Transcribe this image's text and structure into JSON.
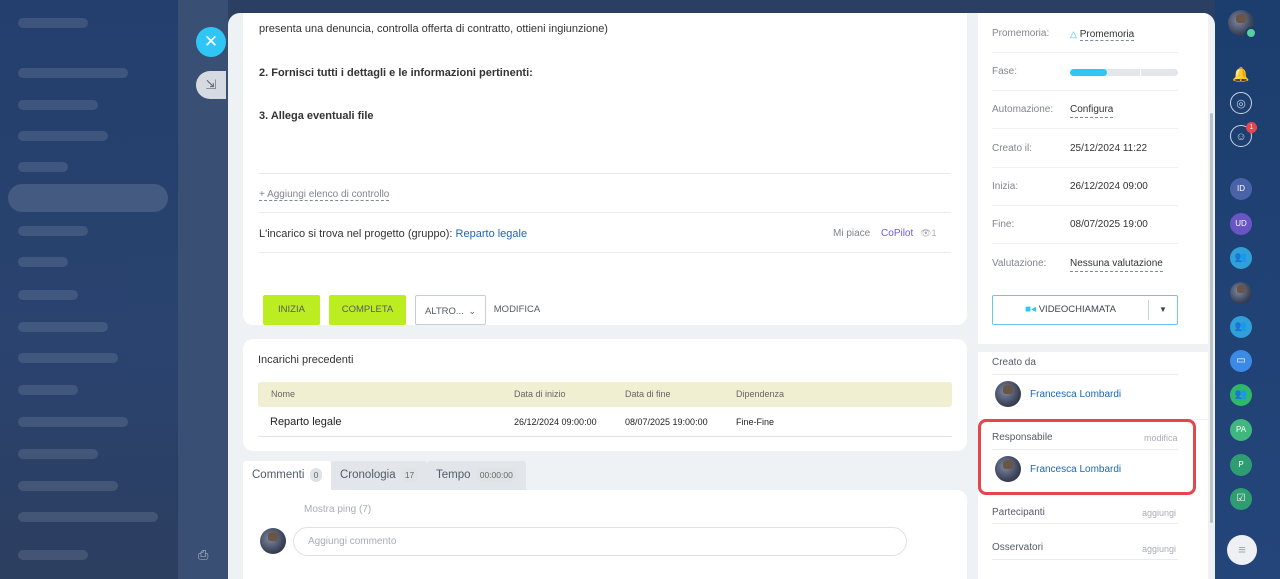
{
  "task": {
    "description_lines": [
      "presenta una denuncia, controlla offerta di contratto, ottieni ingiunzione)",
      "2. Fornisci tutti i dettagli e le informazioni pertinenti:",
      "3. Allega eventuali file"
    ],
    "add_checklist": "+ Aggiungi elenco di controllo",
    "project_prefix": "L'incarico si trova nel progetto (gruppo):",
    "project_name": "Reparto legale",
    "like": "Mi piace",
    "copilot": "CoPilot",
    "views": "1"
  },
  "actions": {
    "start": "INIZIA",
    "complete": "COMPLETA",
    "more": "ALTRO...",
    "edit": "MODIFICA"
  },
  "previous_tasks": {
    "title": "Incarichi precedenti",
    "columns": [
      "Nome",
      "Data di inizio",
      "Data di fine",
      "Dipendenza"
    ],
    "rows": [
      {
        "name": "Reparto legale",
        "start": "26/12/2024 09:00:00",
        "end": "08/07/2025 19:00:00",
        "dependency": "Fine-Fine"
      }
    ]
  },
  "tabs": [
    {
      "label": "Commenti",
      "count": "0"
    },
    {
      "label": "Cronologia",
      "count": "17"
    },
    {
      "label": "Tempo",
      "count": "00:00:00"
    }
  ],
  "comments": {
    "show_pings": "Mostra ping (7)",
    "placeholder": "Aggiungi commento"
  },
  "info": {
    "reminder_label": "Promemoria:",
    "reminder_value": "Promemoria",
    "stage_label": "Fase:",
    "stage_progress": 0.34,
    "automation_label": "Automazione:",
    "automation_value": "Configura",
    "created_label": "Creato il:",
    "created_value": "25/12/2024 11:22",
    "start_label": "Inizia:",
    "start_value": "26/12/2024 09:00",
    "end_label": "Fine:",
    "end_value": "08/07/2025 19:00",
    "rating_label": "Valutazione:",
    "rating_value": "Nessuna valutazione",
    "video_call": "VIDEOCHIAMATA",
    "created_by_label": "Creato da",
    "created_by": "Francesca Lombardi",
    "responsible_label": "Responsabile",
    "responsible_change": "modifica",
    "responsible": "Francesca Lombardi",
    "participants_label": "Partecipanti",
    "participants_add": "aggiungi",
    "observers_label": "Osservatori",
    "observers_add": "aggiungi"
  },
  "rail": {
    "badge": "1",
    "avatars": [
      "ID",
      "UD",
      "PA",
      "P"
    ]
  },
  "colors": {
    "accent": "#2fc6f6",
    "green_button": "#bbed21",
    "highlight": "#e4464c",
    "link": "#2066b0"
  }
}
